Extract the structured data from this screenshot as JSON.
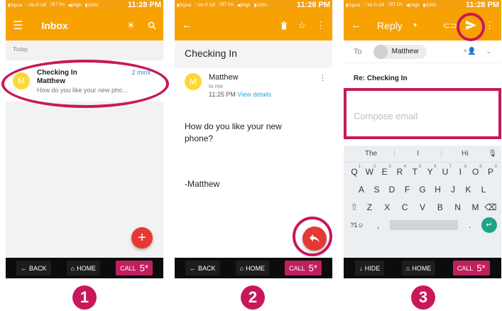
{
  "status_bar": {
    "signal": "Signal",
    "wifi": "Wi-Fi Off",
    "bt": "BT On",
    "volume": "High",
    "battery": "100%",
    "clock": "11:28 PM"
  },
  "navbar": {
    "back": "BACK",
    "home": "HOME",
    "hide": "HIDE",
    "call": "CALL",
    "call_num": "5*"
  },
  "screen1": {
    "title": "Inbox",
    "section": "Today",
    "email": {
      "avatar_letter": "M",
      "subject": "Checking In",
      "sender": "Matthew",
      "time": "2 mins",
      "preview": "How do you like your new pho..."
    },
    "fab": "+"
  },
  "screen2": {
    "subject": "Checking In",
    "avatar_letter": "M",
    "sender": "Matthew",
    "to": "to me",
    "time": "11:25 PM",
    "view_details": "View details",
    "body": "How do you like your new phone?",
    "signature": "-Matthew"
  },
  "screen3": {
    "title": "Reply",
    "to_label": "To",
    "recipient": "Matthew",
    "subject": "Re: Checking In",
    "compose_placeholder": "Compose email",
    "suggestions": [
      "The",
      "I",
      "Hi"
    ],
    "keyboard": {
      "row1": [
        "Q",
        "W",
        "E",
        "R",
        "T",
        "Y",
        "U",
        "I",
        "O",
        "P"
      ],
      "row1_nums": [
        "1",
        "2",
        "3",
        "4",
        "5",
        "6",
        "7",
        "8",
        "9",
        "0"
      ],
      "row2": [
        "A",
        "S",
        "D",
        "F",
        "G",
        "H",
        "J",
        "K",
        "L"
      ],
      "row3": [
        "Z",
        "X",
        "C",
        "V",
        "B",
        "N",
        "M"
      ],
      "sym": "?1☺",
      "comma": ",",
      "period": "."
    }
  },
  "steps": [
    "1",
    "2",
    "3"
  ],
  "colors": {
    "accent": "#f7a200",
    "annotation": "#c8185a",
    "link": "#29a8e0",
    "fab": "#e53935"
  }
}
